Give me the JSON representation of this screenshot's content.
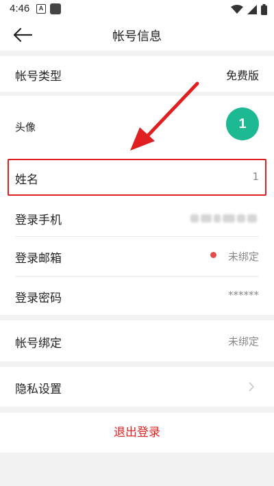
{
  "status_bar": {
    "time": "4:46",
    "badge": "A"
  },
  "nav": {
    "title": "帐号信息"
  },
  "account_type": {
    "label": "帐号类型",
    "value": "免费版"
  },
  "avatar": {
    "label": "头像",
    "text": "1"
  },
  "name": {
    "label": "姓名",
    "value": "1"
  },
  "phone": {
    "label": "登录手机"
  },
  "email": {
    "label": "登录邮箱",
    "value": "未绑定"
  },
  "password": {
    "label": "登录密码",
    "value": "******"
  },
  "binding": {
    "label": "帐号绑定",
    "value": "未绑定"
  },
  "privacy": {
    "label": "隐私设置"
  },
  "logout": {
    "label": "退出登录"
  },
  "colors": {
    "accent_red": "#e02020",
    "avatar_green": "#1db992",
    "dot_red": "#e74c4c"
  },
  "icons": [
    "back-arrow-icon",
    "wifi-icon",
    "signal-icon",
    "battery-icon",
    "chevron-right-icon"
  ]
}
